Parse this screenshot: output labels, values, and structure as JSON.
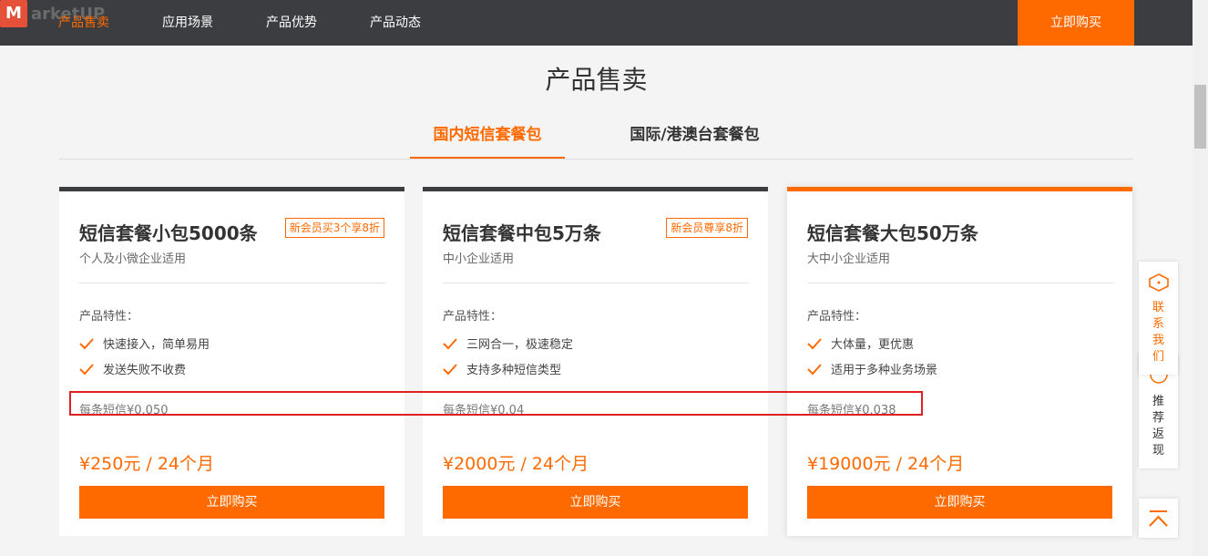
{
  "logo": {
    "mark": "M",
    "text": "arketUP"
  },
  "nav": {
    "items": [
      "产品售卖",
      "应用场景",
      "产品优势",
      "产品动态"
    ],
    "buy": "立即购买"
  },
  "section_title": "产品售卖",
  "tabs": [
    "国内短信套餐包",
    "国际/港澳台套餐包"
  ],
  "features_label": "产品特性：",
  "buy_label": "立即购买",
  "cards": [
    {
      "title": "短信套餐小包5000条",
      "badge": "新会员买3个享8折",
      "subtitle": "个人及小微企业适用",
      "features": [
        "快速接入，简单易用",
        "发送失败不收费"
      ],
      "unit_price": "每条短信¥0.050",
      "price": "¥250元 / 24个月"
    },
    {
      "title": "短信套餐中包5万条",
      "badge": "新会员尊享8折",
      "subtitle": "中小企业适用",
      "features": [
        "三网合一，极速稳定",
        "支持多种短信类型"
      ],
      "unit_price": "每条短信¥0.04",
      "price": "¥2000元 / 24个月"
    },
    {
      "title": "短信套餐大包50万条",
      "badge": "",
      "subtitle": "大中小企业适用",
      "features": [
        "大体量，更优惠",
        "适用于多种业务场景"
      ],
      "unit_price": "每条短信¥0.038",
      "price": "¥19000元 / 24个月"
    }
  ],
  "float": {
    "contact": [
      "联",
      "系",
      "我",
      "们"
    ],
    "recommend": [
      "推",
      "荐",
      "返",
      "现"
    ]
  },
  "colors": {
    "accent": "#ff6a00",
    "nav_bg": "#3c3d40",
    "highlight": "#e02020"
  }
}
